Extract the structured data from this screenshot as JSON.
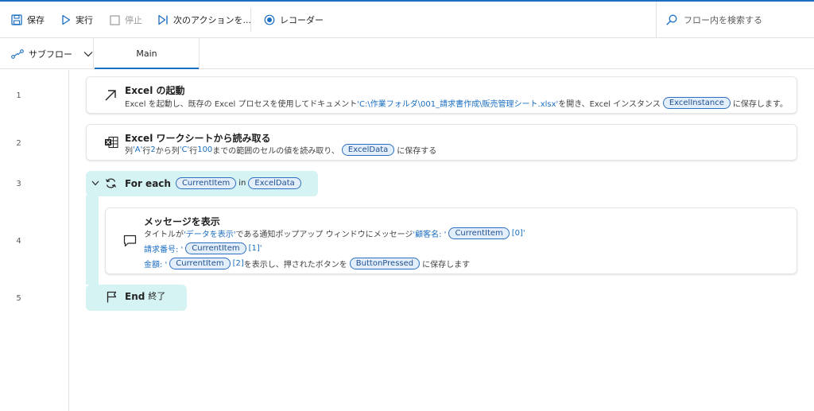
{
  "toolbar": {
    "save": "保存",
    "run": "実行",
    "stop": "停止",
    "next_action": "次のアクションを...",
    "recorder": "レコーダー",
    "search_placeholder": "フロー内を検索する"
  },
  "tabs": {
    "subflows": "サブフロー",
    "main": "Main"
  },
  "lines": [
    "1",
    "2",
    "3",
    "4",
    "5"
  ],
  "actions": {
    "a1": {
      "title": "Excel の起動",
      "d1": "Excel を起動し、既存の Excel プロセスを使用してドキュメント ",
      "path": "'C:\\作業フォルダ\\001_請求書作成\\販売管理シート.xlsx'",
      "d2": " を開き、Excel インスタンス ",
      "var": "ExcelInstance",
      "d3": " に保存します。"
    },
    "a2": {
      "title": "Excel ワークシートから読み取る",
      "d1": "列 ",
      "col1": "'A'",
      "d2": " 行 ",
      "row1": "2",
      "d3": " から列 ",
      "col2": "'C'",
      "d4": " 行 ",
      "row2": "100",
      "d5": " までの範囲のセルの値を読み取り、",
      "var": "ExcelData",
      "d6": " に保存する"
    },
    "a3": {
      "title": "For each",
      "var1": "CurrentItem",
      "in": "in",
      "var2": "ExcelData"
    },
    "a4": {
      "title": "メッセージを表示",
      "l1a": "タイトルが ",
      "l1b": "'データを表示'",
      "l1c": " である通知ポップアップ ウィンドウにメッセージ ",
      "l1d": "'顧客名: '",
      "l1var": "CurrentItem",
      "l1e": "[0]'",
      "l2a": "請求番号: '",
      "l2var": "CurrentItem",
      "l2b": "[1]'",
      "l3a": "金額: '",
      "l3var": "CurrentItem",
      "l3b": "[2]",
      "l3c": " を表示し、押されたボタンを ",
      "l3var2": "ButtonPressed",
      "l3d": " に保存します"
    },
    "a5": {
      "title": "End",
      "sub": "終了"
    }
  }
}
